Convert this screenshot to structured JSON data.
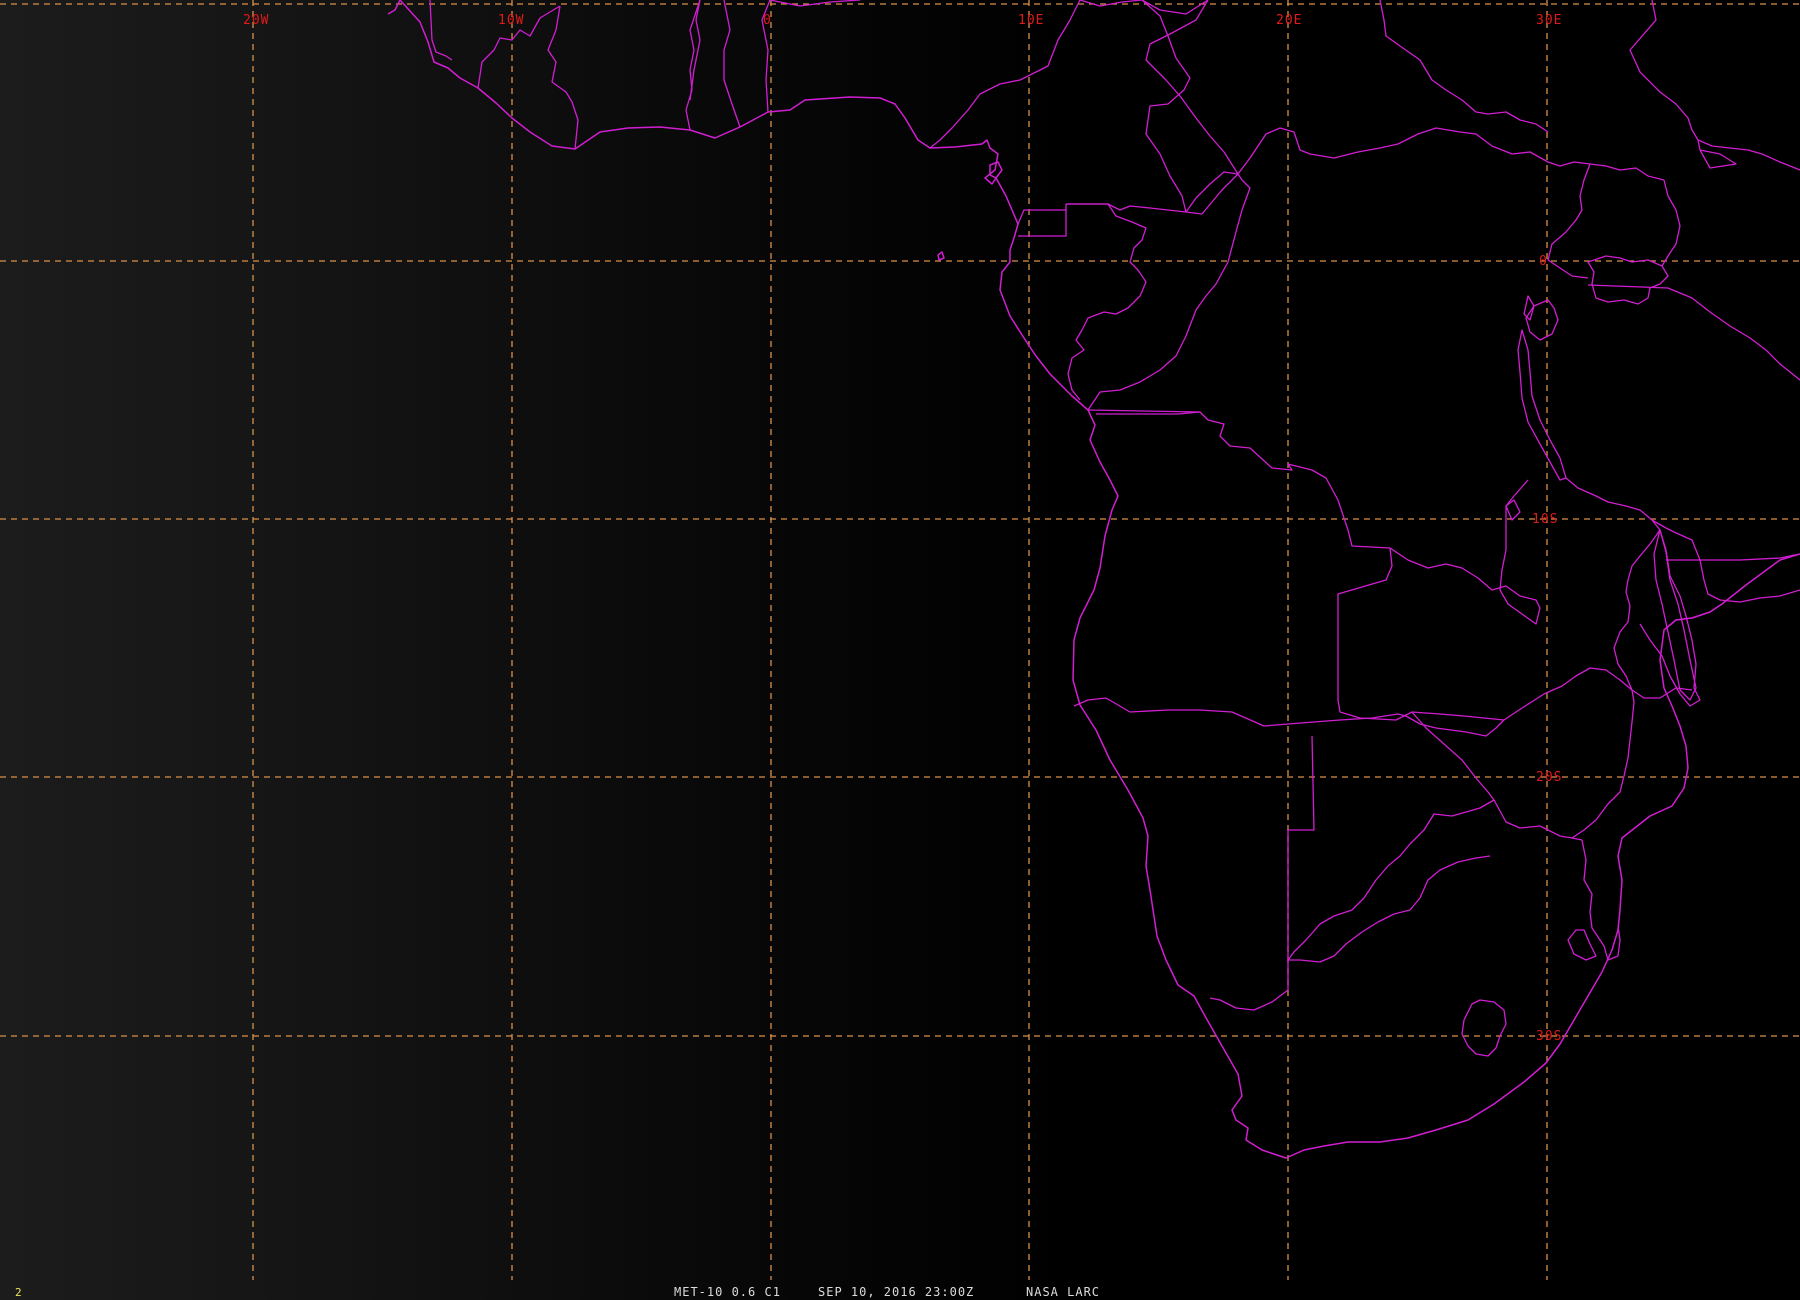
{
  "map": {
    "grid": {
      "longitude_labels": [
        "20W",
        "10W",
        "0",
        "10E",
        "20E",
        "30E"
      ],
      "latitude_labels": [
        "0",
        "10S",
        "20S",
        "30S"
      ]
    },
    "colors": {
      "background": "#000000",
      "grid": "#d9904a",
      "grid_labels": "#e01a1a",
      "boundaries": "#d21ed2",
      "footer_text": "#dcdcdc",
      "frame_number": "#e8e85a"
    }
  },
  "footer": {
    "frame_number": "2",
    "satellite_channel": "MET-10 0.6 C1",
    "datetime": "SEP 10, 2016 23:00Z",
    "source": "NASA LARC"
  }
}
